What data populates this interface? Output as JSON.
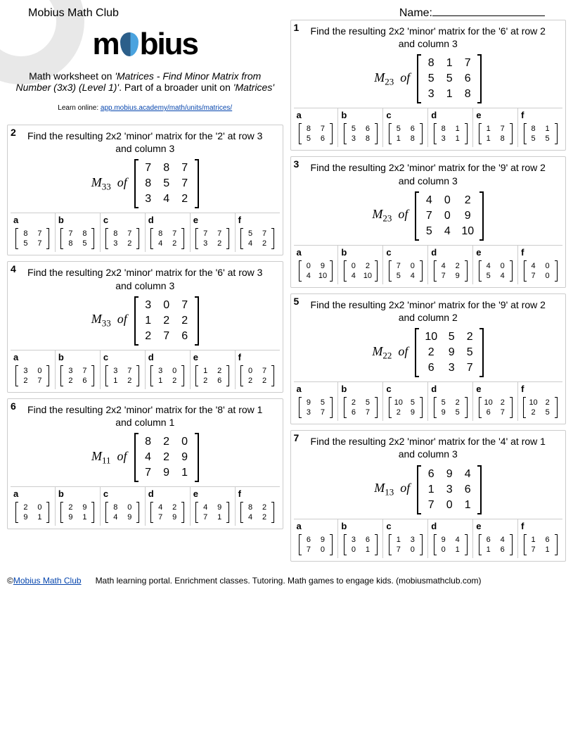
{
  "header": {
    "title": "Mobius Math Club",
    "name_label": "Name:"
  },
  "intro": {
    "logo_pre": "m",
    "logo_post": "bius",
    "desc_pre": "Math worksheet on ",
    "desc_topic": "'Matrices - Find Minor Matrix from Number (3x3) (Level 1)'",
    "desc_mid": ". Part of a broader unit on ",
    "desc_unit": "'Matrices'",
    "link_pre": "Learn online: ",
    "link": "app.mobius.academy/math/units/matrices/"
  },
  "problems": [
    {
      "num": "1",
      "text": "Find the resulting 2x2 'minor' matrix for the '6' at row 2 and column 3",
      "label": "M",
      "sub": "23",
      "of": "of",
      "matrix": [
        [
          "8",
          "1",
          "7"
        ],
        [
          "5",
          "5",
          "6"
        ],
        [
          "3",
          "1",
          "8"
        ]
      ],
      "answers": [
        {
          "l": "a",
          "m": [
            [
              "8",
              "7"
            ],
            [
              "5",
              "6"
            ]
          ]
        },
        {
          "l": "b",
          "m": [
            [
              "5",
              "6"
            ],
            [
              "3",
              "8"
            ]
          ]
        },
        {
          "l": "c",
          "m": [
            [
              "5",
              "6"
            ],
            [
              "1",
              "8"
            ]
          ]
        },
        {
          "l": "d",
          "m": [
            [
              "8",
              "1"
            ],
            [
              "3",
              "1"
            ]
          ]
        },
        {
          "l": "e",
          "m": [
            [
              "1",
              "7"
            ],
            [
              "1",
              "8"
            ]
          ]
        },
        {
          "l": "f",
          "m": [
            [
              "8",
              "1"
            ],
            [
              "5",
              "5"
            ]
          ]
        }
      ]
    },
    {
      "num": "2",
      "text": "Find the resulting 2x2 'minor' matrix for the '2' at row 3 and column 3",
      "label": "M",
      "sub": "33",
      "of": "of",
      "matrix": [
        [
          "7",
          "8",
          "7"
        ],
        [
          "8",
          "5",
          "7"
        ],
        [
          "3",
          "4",
          "2"
        ]
      ],
      "answers": [
        {
          "l": "a",
          "m": [
            [
              "8",
              "7"
            ],
            [
              "5",
              "7"
            ]
          ]
        },
        {
          "l": "b",
          "m": [
            [
              "7",
              "8"
            ],
            [
              "8",
              "5"
            ]
          ]
        },
        {
          "l": "c",
          "m": [
            [
              "8",
              "7"
            ],
            [
              "3",
              "2"
            ]
          ]
        },
        {
          "l": "d",
          "m": [
            [
              "8",
              "7"
            ],
            [
              "4",
              "2"
            ]
          ]
        },
        {
          "l": "e",
          "m": [
            [
              "7",
              "7"
            ],
            [
              "3",
              "2"
            ]
          ]
        },
        {
          "l": "f",
          "m": [
            [
              "5",
              "7"
            ],
            [
              "4",
              "2"
            ]
          ]
        }
      ]
    },
    {
      "num": "3",
      "text": "Find the resulting 2x2 'minor' matrix for the '9' at row 2 and column 3",
      "label": "M",
      "sub": "23",
      "of": "of",
      "matrix": [
        [
          "4",
          "0",
          "2"
        ],
        [
          "7",
          "0",
          "9"
        ],
        [
          "5",
          "4",
          "10"
        ]
      ],
      "answers": [
        {
          "l": "a",
          "m": [
            [
              "0",
              "9"
            ],
            [
              "4",
              "10"
            ]
          ]
        },
        {
          "l": "b",
          "m": [
            [
              "0",
              "2"
            ],
            [
              "4",
              "10"
            ]
          ]
        },
        {
          "l": "c",
          "m": [
            [
              "7",
              "0"
            ],
            [
              "5",
              "4"
            ]
          ]
        },
        {
          "l": "d",
          "m": [
            [
              "4",
              "2"
            ],
            [
              "7",
              "9"
            ]
          ]
        },
        {
          "l": "e",
          "m": [
            [
              "4",
              "0"
            ],
            [
              "5",
              "4"
            ]
          ]
        },
        {
          "l": "f",
          "m": [
            [
              "4",
              "0"
            ],
            [
              "7",
              "0"
            ]
          ]
        }
      ]
    },
    {
      "num": "4",
      "text": "Find the resulting 2x2 'minor' matrix for the '6' at row 3 and column 3",
      "label": "M",
      "sub": "33",
      "of": "of",
      "matrix": [
        [
          "3",
          "0",
          "7"
        ],
        [
          "1",
          "2",
          "2"
        ],
        [
          "2",
          "7",
          "6"
        ]
      ],
      "answers": [
        {
          "l": "a",
          "m": [
            [
              "3",
              "0"
            ],
            [
              "2",
              "7"
            ]
          ]
        },
        {
          "l": "b",
          "m": [
            [
              "3",
              "7"
            ],
            [
              "2",
              "6"
            ]
          ]
        },
        {
          "l": "c",
          "m": [
            [
              "3",
              "7"
            ],
            [
              "1",
              "2"
            ]
          ]
        },
        {
          "l": "d",
          "m": [
            [
              "3",
              "0"
            ],
            [
              "1",
              "2"
            ]
          ]
        },
        {
          "l": "e",
          "m": [
            [
              "1",
              "2"
            ],
            [
              "2",
              "6"
            ]
          ]
        },
        {
          "l": "f",
          "m": [
            [
              "0",
              "7"
            ],
            [
              "2",
              "2"
            ]
          ]
        }
      ]
    },
    {
      "num": "5",
      "text": "Find the resulting 2x2 'minor' matrix for the '9' at row 2 and column 2",
      "label": "M",
      "sub": "22",
      "of": "of",
      "matrix": [
        [
          "10",
          "5",
          "2"
        ],
        [
          "2",
          "9",
          "5"
        ],
        [
          "6",
          "3",
          "7"
        ]
      ],
      "answers": [
        {
          "l": "a",
          "m": [
            [
              "9",
              "5"
            ],
            [
              "3",
              "7"
            ]
          ]
        },
        {
          "l": "b",
          "m": [
            [
              "2",
              "5"
            ],
            [
              "6",
              "7"
            ]
          ]
        },
        {
          "l": "c",
          "m": [
            [
              "10",
              "5"
            ],
            [
              "2",
              "9"
            ]
          ]
        },
        {
          "l": "d",
          "m": [
            [
              "5",
              "2"
            ],
            [
              "9",
              "5"
            ]
          ]
        },
        {
          "l": "e",
          "m": [
            [
              "10",
              "2"
            ],
            [
              "6",
              "7"
            ]
          ]
        },
        {
          "l": "f",
          "m": [
            [
              "10",
              "2"
            ],
            [
              "2",
              "5"
            ]
          ]
        }
      ]
    },
    {
      "num": "6",
      "text": "Find the resulting 2x2 'minor' matrix for the '8' at row 1 and column 1",
      "label": "M",
      "sub": "11",
      "of": "of",
      "matrix": [
        [
          "8",
          "2",
          "0"
        ],
        [
          "4",
          "2",
          "9"
        ],
        [
          "7",
          "9",
          "1"
        ]
      ],
      "answers": [
        {
          "l": "a",
          "m": [
            [
              "2",
              "0"
            ],
            [
              "9",
              "1"
            ]
          ]
        },
        {
          "l": "b",
          "m": [
            [
              "2",
              "9"
            ],
            [
              "9",
              "1"
            ]
          ]
        },
        {
          "l": "c",
          "m": [
            [
              "8",
              "0"
            ],
            [
              "4",
              "9"
            ]
          ]
        },
        {
          "l": "d",
          "m": [
            [
              "4",
              "2"
            ],
            [
              "7",
              "9"
            ]
          ]
        },
        {
          "l": "e",
          "m": [
            [
              "4",
              "9"
            ],
            [
              "7",
              "1"
            ]
          ]
        },
        {
          "l": "f",
          "m": [
            [
              "8",
              "2"
            ],
            [
              "4",
              "2"
            ]
          ]
        }
      ]
    },
    {
      "num": "7",
      "text": "Find the resulting 2x2 'minor' matrix for the '4' at row 1 and column 3",
      "label": "M",
      "sub": "13",
      "of": "of",
      "matrix": [
        [
          "6",
          "9",
          "4"
        ],
        [
          "1",
          "3",
          "6"
        ],
        [
          "7",
          "0",
          "1"
        ]
      ],
      "answers": [
        {
          "l": "a",
          "m": [
            [
              "6",
              "9"
            ],
            [
              "7",
              "0"
            ]
          ]
        },
        {
          "l": "b",
          "m": [
            [
              "3",
              "6"
            ],
            [
              "0",
              "1"
            ]
          ]
        },
        {
          "l": "c",
          "m": [
            [
              "1",
              "3"
            ],
            [
              "7",
              "0"
            ]
          ]
        },
        {
          "l": "d",
          "m": [
            [
              "9",
              "4"
            ],
            [
              "0",
              "1"
            ]
          ]
        },
        {
          "l": "e",
          "m": [
            [
              "6",
              "4"
            ],
            [
              "1",
              "6"
            ]
          ]
        },
        {
          "l": "f",
          "m": [
            [
              "1",
              "6"
            ],
            [
              "7",
              "1"
            ]
          ]
        }
      ]
    }
  ],
  "footer": {
    "copy": "©",
    "link": "Mobius Math Club",
    "text": "Math learning portal. Enrichment classes. Tutoring. Math games to engage kids. (mobiusmathclub.com)"
  }
}
